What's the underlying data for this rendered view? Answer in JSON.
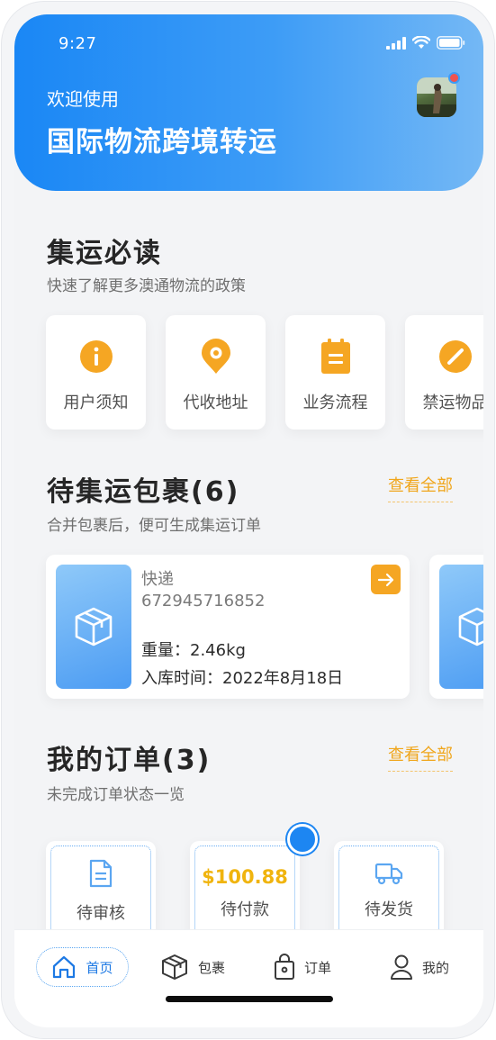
{
  "status_bar": {
    "time": "9:27"
  },
  "header": {
    "welcome": "欢迎使用",
    "title": "国际物流跨境转运"
  },
  "guide": {
    "title": "集运必读",
    "subtitle": "快速了解更多澳通物流的政策",
    "items": [
      {
        "label": "用户须知",
        "icon": "info-icon"
      },
      {
        "label": "代收地址",
        "icon": "location-pin-icon"
      },
      {
        "label": "业务流程",
        "icon": "notepad-icon"
      },
      {
        "label": "禁运物品",
        "icon": "forbidden-icon"
      }
    ]
  },
  "pending": {
    "title": "待集运包裹(6)",
    "subtitle": "合并包裹后，便可生成集运订单",
    "view_all": "查看全部",
    "parcels": [
      {
        "type": "快递",
        "tracking": "672945716852",
        "weight": "重量：2.46kg",
        "date": "入库时间：2022年8月18日"
      }
    ]
  },
  "orders": {
    "title": "我的订单(3)",
    "subtitle": "未完成订单状态一览",
    "view_all": "查看全部",
    "items": [
      {
        "label": "待审核",
        "icon": "document-icon"
      },
      {
        "label": "待付款",
        "amount": "$100.88"
      },
      {
        "label": "待发货",
        "icon": "truck-icon"
      }
    ]
  },
  "tabs": [
    {
      "label": "首页",
      "icon": "home-icon",
      "active": true
    },
    {
      "label": "包裹",
      "icon": "package-icon"
    },
    {
      "label": "订单",
      "icon": "bag-icon"
    },
    {
      "label": "我的",
      "icon": "user-icon"
    }
  ],
  "colors": {
    "primary": "#1a87f5",
    "accent": "#f5a623"
  }
}
